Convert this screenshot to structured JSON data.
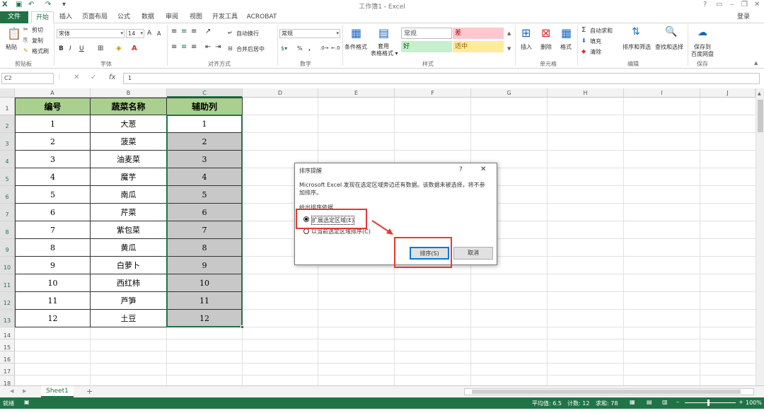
{
  "window": {
    "title": "工作簿1 - Excel",
    "login": "登录",
    "help": "?"
  },
  "tabs": [
    "文件",
    "开始",
    "插入",
    "页面布局",
    "公式",
    "数据",
    "审阅",
    "视图",
    "开发工具",
    "ACROBAT"
  ],
  "ribbon": {
    "clipboard": {
      "paste": "粘贴",
      "cut": "剪切",
      "copy": "复制",
      "format_painter": "格式刷",
      "label": "剪贴板"
    },
    "font": {
      "name": "宋体",
      "size": "14",
      "label": "字体",
      "bold": "B",
      "italic": "I",
      "underline": "U",
      "grow": "A",
      "shrink": "A"
    },
    "alignment": {
      "wrap": "自动换行",
      "merge": "合并后居中",
      "label": "对齐方式"
    },
    "number": {
      "format": "常规",
      "percent": "%",
      "comma": ",",
      "label": "数字"
    },
    "styles": {
      "cond": "条件格式",
      "table": "套用\n表格格式",
      "normal": "常规",
      "bad": "差",
      "good": "好",
      "neutral": "适中",
      "label": "样式"
    },
    "cells": {
      "insert": "插入",
      "delete": "删除",
      "format": "格式",
      "label": "单元格"
    },
    "editing": {
      "autosum": "自动求和",
      "fill": "填充",
      "clear": "清除",
      "sort": "排序和筛选",
      "find": "查找和选择",
      "label": "编辑"
    },
    "save": {
      "line1": "保存到",
      "line2": "百度网盘",
      "label": "保存"
    }
  },
  "formula": {
    "namebox": "C2",
    "fx": "fx",
    "value": "1"
  },
  "columns": [
    "A",
    "B",
    "C",
    "D",
    "E",
    "F",
    "G",
    "H",
    "I",
    "J"
  ],
  "rows": [
    "1",
    "2",
    "3",
    "4",
    "5",
    "6",
    "7",
    "8",
    "9",
    "10",
    "11",
    "12",
    "13",
    "14",
    "15",
    "16",
    "17",
    "18"
  ],
  "table": {
    "headers": [
      "编号",
      "蔬菜名称",
      "辅助列"
    ],
    "rows": [
      [
        "1",
        "大葱",
        "1"
      ],
      [
        "2",
        "菠菜",
        "2"
      ],
      [
        "3",
        "油麦菜",
        "3"
      ],
      [
        "4",
        "魔芋",
        "4"
      ],
      [
        "5",
        "南瓜",
        "5"
      ],
      [
        "6",
        "芹菜",
        "6"
      ],
      [
        "7",
        "紫包菜",
        "7"
      ],
      [
        "8",
        "黄瓜",
        "8"
      ],
      [
        "9",
        "白萝卜",
        "9"
      ],
      [
        "10",
        "西红柿",
        "10"
      ],
      [
        "11",
        "芦笋",
        "11"
      ],
      [
        "12",
        "土豆",
        "12"
      ]
    ]
  },
  "dialog": {
    "title": "排序提醒",
    "help": "?",
    "close": "✕",
    "message1": "Microsoft Excel 发现在选定区域旁边还有数据。该数据未被选择，将不参",
    "message2": "加排序。",
    "group": "给出排序依据",
    "opt1": "扩展选定区域(E)",
    "opt2": "以当前选定区域排序(C)",
    "sort": "排序(S)",
    "cancel": "取消"
  },
  "sheet": {
    "tab": "Sheet1",
    "add": "+"
  },
  "status": {
    "ready": "就绪",
    "average": "平均值: 6.5",
    "count": "计数: 12",
    "sum": "求和: 78",
    "zoom": "100%"
  },
  "colors": {
    "accent": "#217346",
    "header_green": "#a9d08e",
    "highlight_red": "#e53935",
    "selection_gray": "#c8c8c8"
  }
}
